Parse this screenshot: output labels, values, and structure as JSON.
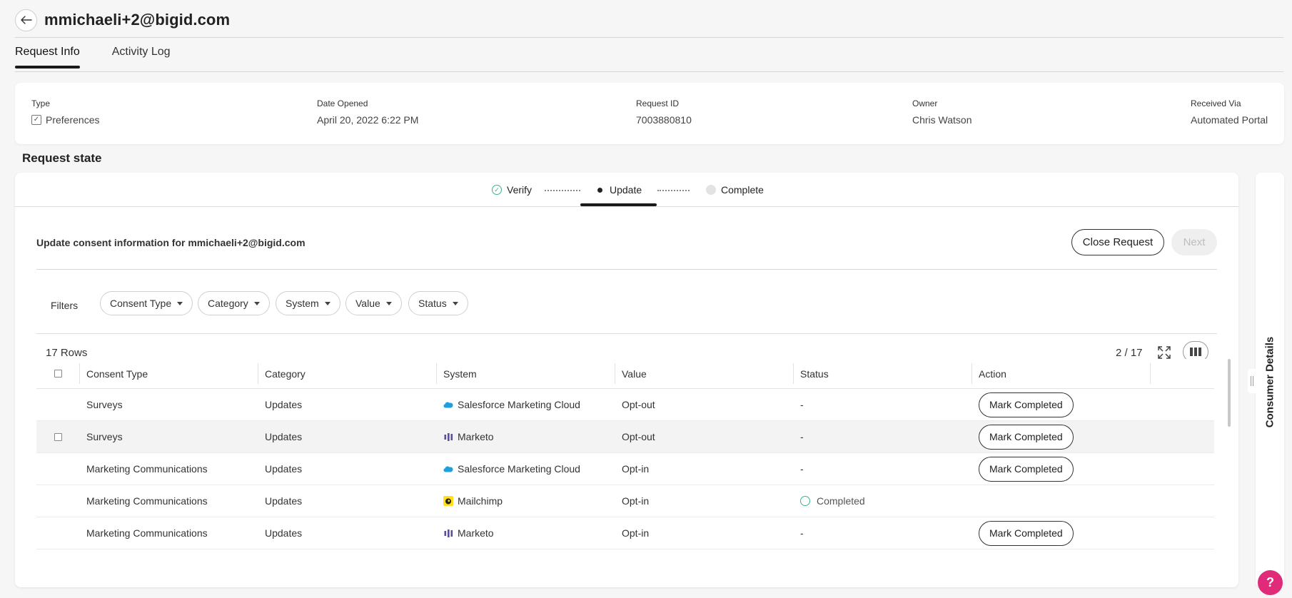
{
  "header": {
    "title": "mmichaeli+2@bigid.com",
    "back_icon": "arrow-left-icon"
  },
  "tabs": [
    {
      "label": "Request Info",
      "active": true
    },
    {
      "label": "Activity Log",
      "active": false
    }
  ],
  "info": {
    "type": {
      "label": "Type",
      "value": "Preferences"
    },
    "date_opened": {
      "label": "Date Opened",
      "value": "April 20, 2022 6:22 PM"
    },
    "request_id": {
      "label": "Request ID",
      "value": "7003880810"
    },
    "owner": {
      "label": "Owner",
      "value": "Chris Watson"
    },
    "received_via": {
      "label": "Received Via",
      "value": "Automated Portal"
    }
  },
  "request_state": {
    "title": "Request state"
  },
  "stepper": {
    "steps": [
      {
        "label": "Verify",
        "state": "done"
      },
      {
        "label": "Update",
        "state": "current"
      },
      {
        "label": "Complete",
        "state": "pending"
      }
    ]
  },
  "update": {
    "heading": "Update consent information for mmichaeli+2@bigid.com",
    "close_label": "Close Request",
    "next_label": "Next"
  },
  "filters": {
    "label": "Filters",
    "chips": [
      "Consent Type",
      "Category",
      "System",
      "Value",
      "Status"
    ]
  },
  "grid": {
    "rows_label": "17 Rows",
    "paging": "2 / 17",
    "columns": [
      "Consent Type",
      "Category",
      "System",
      "Value",
      "Status",
      "Action"
    ],
    "action_label": "Mark Completed",
    "rows": [
      {
        "consent_type": "Surveys",
        "category": "Updates",
        "system": "Salesforce Marketing Cloud",
        "system_icon": "salesforce-icon",
        "value": "Opt-out",
        "status": "-",
        "action": "Mark Completed"
      },
      {
        "consent_type": "Surveys",
        "category": "Updates",
        "system": "Marketo",
        "system_icon": "marketo-icon",
        "value": "Opt-out",
        "status": "-",
        "action": "Mark Completed"
      },
      {
        "consent_type": "Marketing Communications",
        "category": "Updates",
        "system": "Salesforce Marketing Cloud",
        "system_icon": "salesforce-icon",
        "value": "Opt-in",
        "status": "-",
        "action": "Mark Completed"
      },
      {
        "consent_type": "Marketing Communications",
        "category": "Updates",
        "system": "Mailchimp",
        "system_icon": "mailchimp-icon",
        "value": "Opt-in",
        "status": "Completed",
        "action": ""
      },
      {
        "consent_type": "Marketing Communications",
        "category": "Updates",
        "system": "Marketo",
        "system_icon": "marketo-icon",
        "value": "Opt-in",
        "status": "-",
        "action": "Mark Completed"
      }
    ]
  },
  "side_panel": {
    "label": "Consumer Details"
  },
  "help": {
    "label": "?"
  },
  "colors": {
    "accent": "#3eb489",
    "help": "#e02a7a",
    "salesforce": "#1ea0dc",
    "marketo": "#5c4c9f",
    "mailchimp": "#ffe01b"
  }
}
